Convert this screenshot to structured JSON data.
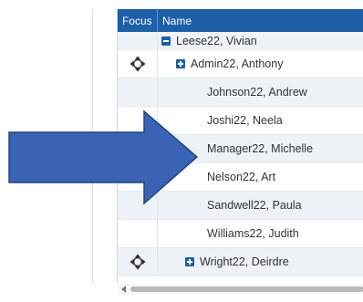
{
  "grid": {
    "headers": {
      "focus": "Focus",
      "name": "Name"
    },
    "rows": [
      {
        "name": "Leese22, Vivian",
        "indent": 1,
        "expander": "collapse-icon",
        "focus_icon": ""
      },
      {
        "name": "Admin22, Anthony",
        "indent": 2,
        "expander": "expand-icon",
        "focus_icon": "move-icon"
      },
      {
        "name": "Johnson22, Andrew",
        "indent": 3,
        "expander": "",
        "focus_icon": ""
      },
      {
        "name": "Joshi22, Neela",
        "indent": 3,
        "expander": "",
        "focus_icon": ""
      },
      {
        "name": "Manager22, Michelle",
        "indent": 3,
        "expander": "",
        "focus_icon": ""
      },
      {
        "name": "Nelson22, Art",
        "indent": 3,
        "expander": "",
        "focus_icon": ""
      },
      {
        "name": "Sandwell22, Paula",
        "indent": 3,
        "expander": "",
        "focus_icon": ""
      },
      {
        "name": "Williams22, Judith",
        "indent": 3,
        "expander": "",
        "focus_icon": ""
      },
      {
        "name": "Wright22, Deirdre",
        "indent": 2,
        "expander": "expand-icon",
        "focus_icon": "move-icon"
      }
    ]
  },
  "colors": {
    "header_bg": "#1f5fa8",
    "row_alt_bg": "#edf2f6",
    "arrow_fill": "#3a63b5",
    "arrow_stroke": "#26437e"
  },
  "annotation": {
    "icon": "right-arrow-callout-icon"
  }
}
